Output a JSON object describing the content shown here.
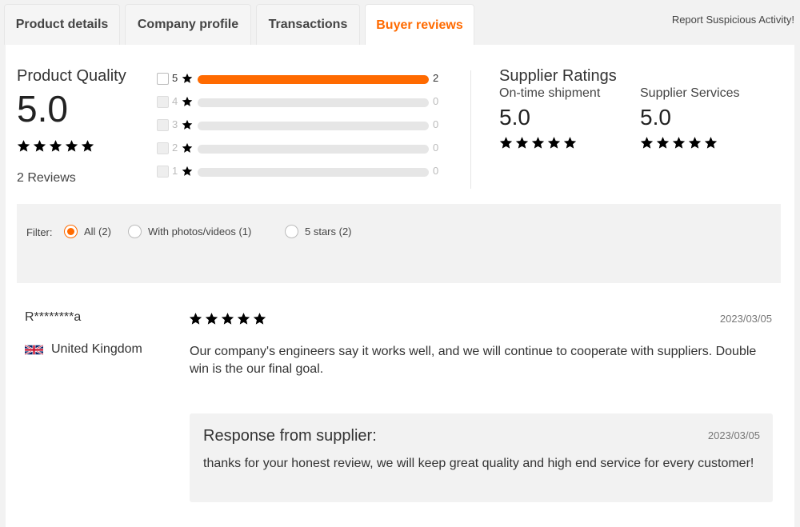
{
  "tabs": [
    {
      "label": "Product details",
      "active": false
    },
    {
      "label": "Company profile",
      "active": false
    },
    {
      "label": "Transactions",
      "active": false
    },
    {
      "label": "Buyer reviews",
      "active": true
    }
  ],
  "report_link": "Report Suspicious Activity!",
  "product_quality": {
    "title": "Product Quality",
    "score": "5.0",
    "stars": 5,
    "reviews_label": "2 Reviews"
  },
  "distribution": [
    {
      "stars": "5",
      "count": "2",
      "fraction": 1.0,
      "enabled": true
    },
    {
      "stars": "4",
      "count": "0",
      "fraction": 0,
      "enabled": false
    },
    {
      "stars": "3",
      "count": "0",
      "fraction": 0,
      "enabled": false
    },
    {
      "stars": "2",
      "count": "0",
      "fraction": 0,
      "enabled": false
    },
    {
      "stars": "1",
      "count": "0",
      "fraction": 0,
      "enabled": false
    }
  ],
  "supplier_ratings": {
    "title": "Supplier Ratings",
    "on_time": {
      "label": "On-time shipment",
      "score": "5.0",
      "stars": 5
    },
    "services": {
      "label": "Supplier Services",
      "score": "5.0",
      "stars": 5
    }
  },
  "filter": {
    "label": "Filter:",
    "options": [
      {
        "label": "All (2)",
        "selected": true
      },
      {
        "label": "With photos/videos (1)",
        "selected": false
      },
      {
        "label": "5 stars (2)",
        "selected": false
      }
    ]
  },
  "review": {
    "reviewer": "R********a",
    "country": "United Kingdom",
    "flag_icon": "uk-flag-icon",
    "stars": 5,
    "date": "2023/03/05",
    "text": "Our company's engineers say it works well, and we will continue to cooperate with suppliers. Double win is the our final goal.",
    "response": {
      "title": "Response from supplier:",
      "date": "2023/03/05",
      "text": "thanks for your honest review, we will keep great quality and high end service for every customer!"
    }
  },
  "colors": {
    "accent": "#ff6a00"
  }
}
